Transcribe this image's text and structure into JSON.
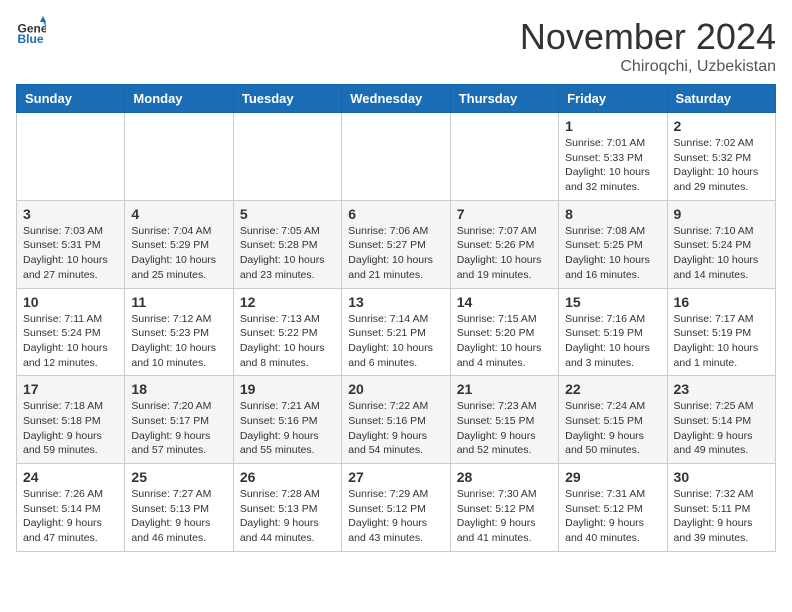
{
  "header": {
    "logo_general": "General",
    "logo_blue": "Blue",
    "month_title": "November 2024",
    "subtitle": "Chiroqchi, Uzbekistan"
  },
  "weekdays": [
    "Sunday",
    "Monday",
    "Tuesday",
    "Wednesday",
    "Thursday",
    "Friday",
    "Saturday"
  ],
  "weeks": [
    [
      {
        "day": "",
        "info": ""
      },
      {
        "day": "",
        "info": ""
      },
      {
        "day": "",
        "info": ""
      },
      {
        "day": "",
        "info": ""
      },
      {
        "day": "",
        "info": ""
      },
      {
        "day": "1",
        "info": "Sunrise: 7:01 AM\nSunset: 5:33 PM\nDaylight: 10 hours\nand 32 minutes."
      },
      {
        "day": "2",
        "info": "Sunrise: 7:02 AM\nSunset: 5:32 PM\nDaylight: 10 hours\nand 29 minutes."
      }
    ],
    [
      {
        "day": "3",
        "info": "Sunrise: 7:03 AM\nSunset: 5:31 PM\nDaylight: 10 hours\nand 27 minutes."
      },
      {
        "day": "4",
        "info": "Sunrise: 7:04 AM\nSunset: 5:29 PM\nDaylight: 10 hours\nand 25 minutes."
      },
      {
        "day": "5",
        "info": "Sunrise: 7:05 AM\nSunset: 5:28 PM\nDaylight: 10 hours\nand 23 minutes."
      },
      {
        "day": "6",
        "info": "Sunrise: 7:06 AM\nSunset: 5:27 PM\nDaylight: 10 hours\nand 21 minutes."
      },
      {
        "day": "7",
        "info": "Sunrise: 7:07 AM\nSunset: 5:26 PM\nDaylight: 10 hours\nand 19 minutes."
      },
      {
        "day": "8",
        "info": "Sunrise: 7:08 AM\nSunset: 5:25 PM\nDaylight: 10 hours\nand 16 minutes."
      },
      {
        "day": "9",
        "info": "Sunrise: 7:10 AM\nSunset: 5:24 PM\nDaylight: 10 hours\nand 14 minutes."
      }
    ],
    [
      {
        "day": "10",
        "info": "Sunrise: 7:11 AM\nSunset: 5:24 PM\nDaylight: 10 hours\nand 12 minutes."
      },
      {
        "day": "11",
        "info": "Sunrise: 7:12 AM\nSunset: 5:23 PM\nDaylight: 10 hours\nand 10 minutes."
      },
      {
        "day": "12",
        "info": "Sunrise: 7:13 AM\nSunset: 5:22 PM\nDaylight: 10 hours\nand 8 minutes."
      },
      {
        "day": "13",
        "info": "Sunrise: 7:14 AM\nSunset: 5:21 PM\nDaylight: 10 hours\nand 6 minutes."
      },
      {
        "day": "14",
        "info": "Sunrise: 7:15 AM\nSunset: 5:20 PM\nDaylight: 10 hours\nand 4 minutes."
      },
      {
        "day": "15",
        "info": "Sunrise: 7:16 AM\nSunset: 5:19 PM\nDaylight: 10 hours\nand 3 minutes."
      },
      {
        "day": "16",
        "info": "Sunrise: 7:17 AM\nSunset: 5:19 PM\nDaylight: 10 hours\nand 1 minute."
      }
    ],
    [
      {
        "day": "17",
        "info": "Sunrise: 7:18 AM\nSunset: 5:18 PM\nDaylight: 9 hours\nand 59 minutes."
      },
      {
        "day": "18",
        "info": "Sunrise: 7:20 AM\nSunset: 5:17 PM\nDaylight: 9 hours\nand 57 minutes."
      },
      {
        "day": "19",
        "info": "Sunrise: 7:21 AM\nSunset: 5:16 PM\nDaylight: 9 hours\nand 55 minutes."
      },
      {
        "day": "20",
        "info": "Sunrise: 7:22 AM\nSunset: 5:16 PM\nDaylight: 9 hours\nand 54 minutes."
      },
      {
        "day": "21",
        "info": "Sunrise: 7:23 AM\nSunset: 5:15 PM\nDaylight: 9 hours\nand 52 minutes."
      },
      {
        "day": "22",
        "info": "Sunrise: 7:24 AM\nSunset: 5:15 PM\nDaylight: 9 hours\nand 50 minutes."
      },
      {
        "day": "23",
        "info": "Sunrise: 7:25 AM\nSunset: 5:14 PM\nDaylight: 9 hours\nand 49 minutes."
      }
    ],
    [
      {
        "day": "24",
        "info": "Sunrise: 7:26 AM\nSunset: 5:14 PM\nDaylight: 9 hours\nand 47 minutes."
      },
      {
        "day": "25",
        "info": "Sunrise: 7:27 AM\nSunset: 5:13 PM\nDaylight: 9 hours\nand 46 minutes."
      },
      {
        "day": "26",
        "info": "Sunrise: 7:28 AM\nSunset: 5:13 PM\nDaylight: 9 hours\nand 44 minutes."
      },
      {
        "day": "27",
        "info": "Sunrise: 7:29 AM\nSunset: 5:12 PM\nDaylight: 9 hours\nand 43 minutes."
      },
      {
        "day": "28",
        "info": "Sunrise: 7:30 AM\nSunset: 5:12 PM\nDaylight: 9 hours\nand 41 minutes."
      },
      {
        "day": "29",
        "info": "Sunrise: 7:31 AM\nSunset: 5:12 PM\nDaylight: 9 hours\nand 40 minutes."
      },
      {
        "day": "30",
        "info": "Sunrise: 7:32 AM\nSunset: 5:11 PM\nDaylight: 9 hours\nand 39 minutes."
      }
    ]
  ]
}
